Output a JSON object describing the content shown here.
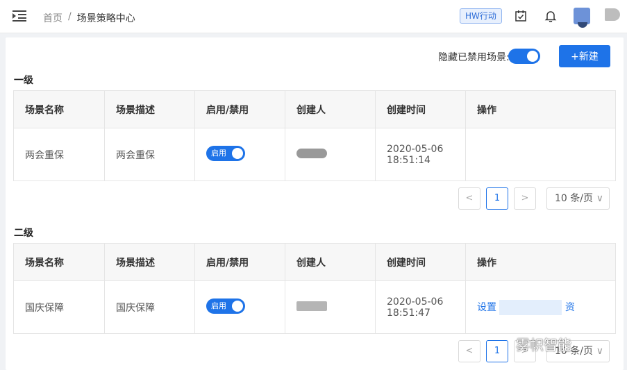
{
  "header": {
    "breadcrumb": [
      "首页",
      "/",
      "场景策略中心"
    ],
    "badge": "HW行动"
  },
  "toolbar": {
    "hide_disabled_label": "隐藏已禁用场景:",
    "new_button": "+新建"
  },
  "columns": [
    "场景名称",
    "场景描述",
    "启用/禁用",
    "创建人",
    "创建时间",
    "操作"
  ],
  "sections": [
    {
      "title": "一级",
      "row": {
        "name": "两会重保",
        "desc": "两会重保",
        "switch_label": "启用",
        "created_time_date": "2020-05-06",
        "created_time_clock": "18:51:14",
        "action": "",
        "action2": ""
      }
    },
    {
      "title": "二级",
      "row": {
        "name": "国庆保障",
        "desc": "国庆保障",
        "switch_label": "启用",
        "created_time_date": "2020-05-06",
        "created_time_clock": "18:51:47",
        "action": "设置",
        "action2": "资"
      }
    }
  ],
  "pagination": {
    "current_page": "1",
    "prev": "<",
    "next": ">",
    "page_size": "10 条/页",
    "caret": "∨"
  },
  "watermark": "雾帜智能",
  "colors": {
    "primary": "#1e73e8"
  }
}
